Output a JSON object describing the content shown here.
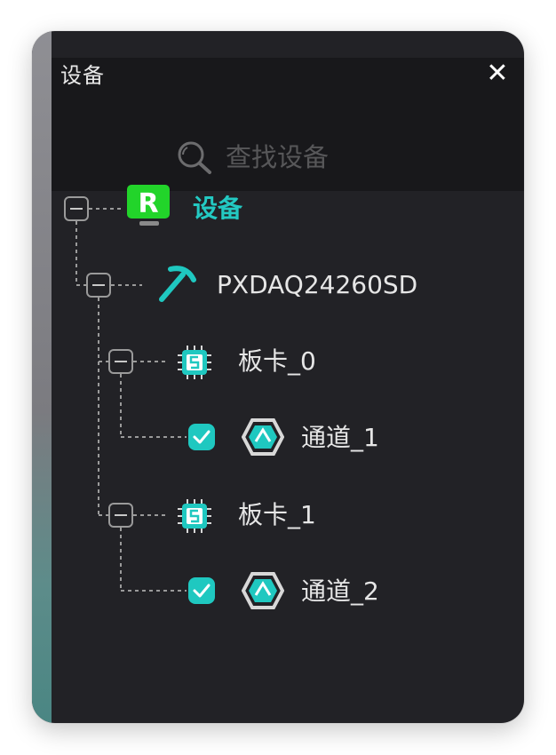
{
  "panel": {
    "title": "设备",
    "close_label": "✕"
  },
  "search": {
    "placeholder": "查找设备",
    "value": ""
  },
  "tree": {
    "root": {
      "label": "设备",
      "icon": "r-device-icon",
      "expanded": true
    },
    "device": {
      "label": "PXDAQ24260SD",
      "icon": "pickaxe-icon",
      "expanded": true
    },
    "boards": [
      {
        "label": "板卡_0",
        "icon": "chip-icon",
        "expanded": true,
        "channels": [
          {
            "label": "通道_1",
            "icon": "channel-icon",
            "checked": true
          }
        ]
      },
      {
        "label": "板卡_1",
        "icon": "chip-icon",
        "expanded": true,
        "channels": [
          {
            "label": "通道_2",
            "icon": "channel-icon",
            "checked": true
          }
        ]
      }
    ]
  },
  "colors": {
    "accent": "#1fc8c0",
    "panel_bg": "#222226",
    "header_bg": "#18181b",
    "device_badge": "#22d42a"
  }
}
